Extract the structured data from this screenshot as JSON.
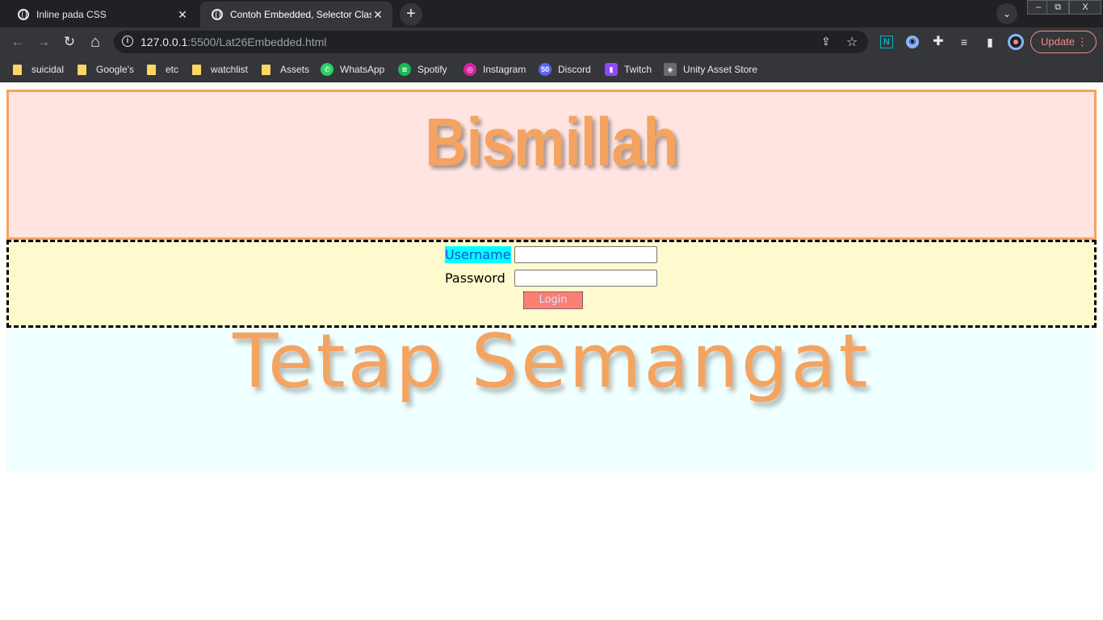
{
  "browser": {
    "tabs": [
      {
        "title": "Inline pada CSS",
        "close": "✕"
      },
      {
        "title": "Contoh Embedded, Selector Class",
        "close": "✕"
      }
    ],
    "new_tab": "+",
    "tab_search": "⌄",
    "window_controls": {
      "minimize": "–",
      "restore": "⧉",
      "close": "X"
    },
    "nav": {
      "back": "←",
      "forward": "→",
      "reload": "↻",
      "home": "⌂"
    },
    "address": {
      "host": "127.0.0.1",
      "rest": ":5500/Lat26Embedded.html",
      "info_icon": "i"
    },
    "update_label": "Update",
    "menu_dots": "⋮"
  },
  "bookmarks": [
    {
      "label": "suicidal",
      "icon": "folder-icon"
    },
    {
      "label": "Google's",
      "icon": "folder-icon"
    },
    {
      "label": "etc",
      "icon": "folder-icon"
    },
    {
      "label": "watchlist",
      "icon": "folder-icon"
    },
    {
      "label": "Assets",
      "icon": "folder-icon"
    },
    {
      "label": "WhatsApp",
      "icon": "whatsapp-icon"
    },
    {
      "label": "Spotify",
      "icon": "spotify-icon"
    },
    {
      "label": "Instagram",
      "icon": "instagram-icon"
    },
    {
      "label": "Discord",
      "icon": "discord-icon",
      "badge": "50"
    },
    {
      "label": "Twitch",
      "icon": "twitch-icon"
    },
    {
      "label": "Unity Asset Store",
      "icon": "unity-icon"
    }
  ],
  "page": {
    "header_title": "Bismillah",
    "form": {
      "username_label": "Username",
      "password_label": "Password",
      "username_value": "",
      "password_value": "",
      "login_label": "Login"
    },
    "footer_title": "Tetap Semangat"
  },
  "colors": {
    "accent": "#f4a460",
    "header_bg": "#ffe4e1",
    "form_bg": "#fffacd",
    "footer_bg": "#f0ffff",
    "username_highlight": "#00ffff",
    "login_bg": "#fa8072"
  }
}
